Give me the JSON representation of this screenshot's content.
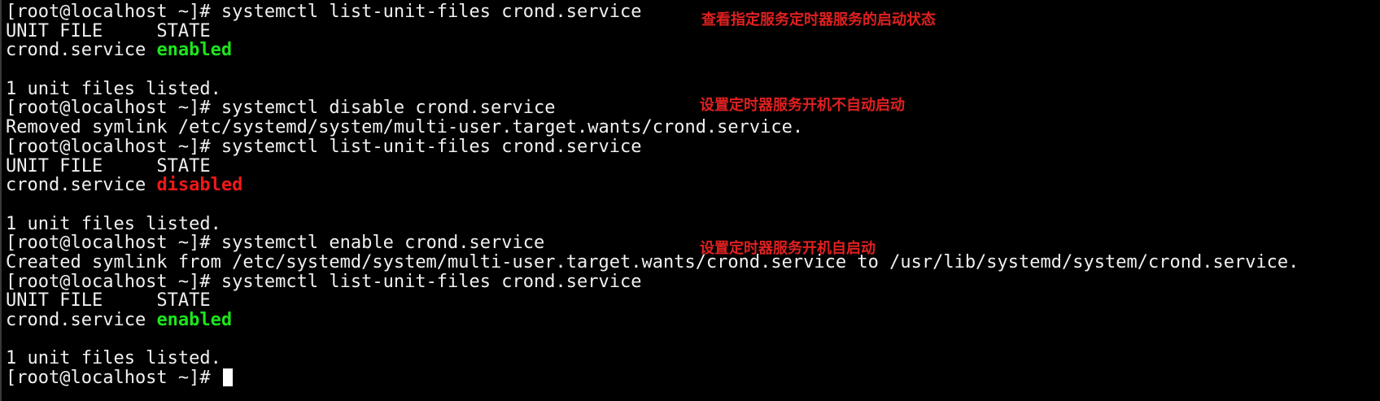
{
  "terminal": {
    "prompt": "[root@localhost ~]# ",
    "blocks": [
      {
        "command": "systemctl list-unit-files crond.service"
      },
      {
        "header": "UNIT FILE     STATE"
      },
      {
        "unit": "crond.service ",
        "state": "enabled"
      },
      {
        "summary": "1 unit files listed."
      },
      {
        "command": "systemctl disable crond.service"
      },
      {
        "output": "Removed symlink /etc/systemd/system/multi-user.target.wants/crond.service."
      },
      {
        "command": "systemctl list-unit-files crond.service"
      },
      {
        "header": "UNIT FILE     STATE"
      },
      {
        "unit": "crond.service ",
        "state": "disabled"
      },
      {
        "summary": "1 unit files listed."
      },
      {
        "command": "systemctl enable crond.service"
      },
      {
        "output": "Created symlink from /etc/systemd/system/multi-user.target.wants/crond.service to /usr/lib/systemd/system/crond.service."
      },
      {
        "command": "systemctl list-unit-files crond.service"
      },
      {
        "header": "UNIT FILE     STATE"
      },
      {
        "unit": "crond.service ",
        "state": "enabled"
      },
      {
        "summary": "1 unit files listed."
      }
    ]
  },
  "annotations": {
    "note_1": "查看指定服务定时器服务的启动状态",
    "note_2": "设置定时器服务开机不自动启动",
    "note_3": "设置定时器服务开机自启动"
  },
  "colors": {
    "background": "#000000",
    "text": "#f0f0f0",
    "enabled": "#1de41d",
    "disabled": "#f01818",
    "annotation": "#e02020"
  }
}
